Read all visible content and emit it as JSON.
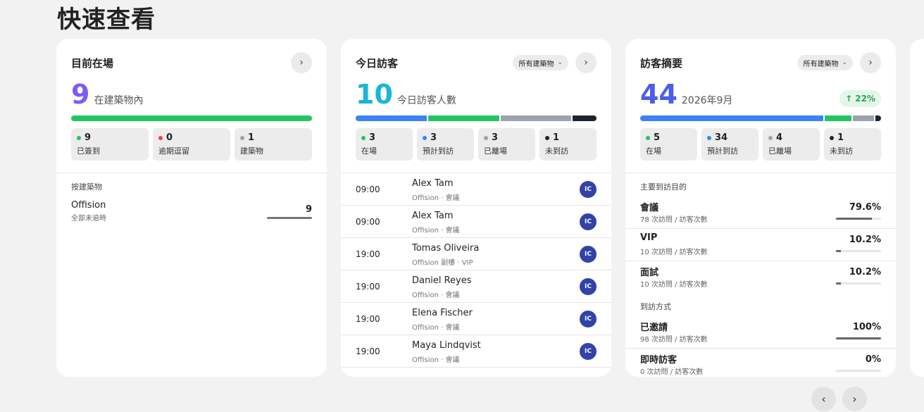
{
  "page_title": "快速查看",
  "colors": {
    "green": "#22c55e",
    "red": "#ef4444",
    "gray": "#9ca3af",
    "dark": "#1e2330",
    "blue": "#3b82f6",
    "purple": "#7c5cf5",
    "cyan": "#19b6d6",
    "indigo": "#4b5ee8"
  },
  "icons": {
    "chevron_right": "›",
    "chevron_down": "⌄",
    "arrow_up": "↑",
    "prev": "‹",
    "next": "›"
  },
  "card1": {
    "title": "目前在場",
    "count": "9",
    "count_label": "在建築物內",
    "stats": [
      {
        "value": "9",
        "label": "已簽到"
      },
      {
        "value": "0",
        "label": "逾期逗留"
      },
      {
        "value": "1",
        "label": "建築物"
      }
    ],
    "section_label": "按建築物",
    "building": {
      "name": "Offision",
      "sub": "全部未逾時",
      "count": "9"
    }
  },
  "card2": {
    "title": "今日訪客",
    "filter": "所有建築物",
    "count": "10",
    "count_label": "今日訪客人數",
    "stats": [
      {
        "value": "3",
        "label": "在場"
      },
      {
        "value": "3",
        "label": "預計到訪"
      },
      {
        "value": "3",
        "label": "已離場"
      },
      {
        "value": "1",
        "label": "未到訪"
      }
    ],
    "visits": [
      {
        "time": "09:00",
        "name": "Alex Tam",
        "sub": "Offision · 會議",
        "initials": "IC"
      },
      {
        "time": "09:00",
        "name": "Alex Tam",
        "sub": "Offision · 會議",
        "initials": "IC"
      },
      {
        "time": "19:00",
        "name": "Tomas Oliveira",
        "sub": "Offision 副樓 · VIP",
        "initials": "IC"
      },
      {
        "time": "19:00",
        "name": "Daniel Reyes",
        "sub": "Offision · 會議",
        "initials": "IC"
      },
      {
        "time": "19:00",
        "name": "Elena Fischer",
        "sub": "Offision · 會議",
        "initials": "IC"
      },
      {
        "time": "19:00",
        "name": "Maya Lindqvist",
        "sub": "Offision · 會議",
        "initials": "IC"
      }
    ]
  },
  "card3": {
    "title": "訪客摘要",
    "filter": "所有建築物",
    "count": "44",
    "count_label": "2026年9月",
    "trend": "22%",
    "stats": [
      {
        "value": "5",
        "label": "在場"
      },
      {
        "value": "34",
        "label": "預計到訪"
      },
      {
        "value": "4",
        "label": "已離場"
      },
      {
        "value": "1",
        "label": "未到訪"
      }
    ],
    "purpose_label": "主要到訪目的",
    "purposes": [
      {
        "name": "會議",
        "sub": "78 次訪問 / 訪客次數",
        "pct": "79.6%",
        "fraction": 0.796
      },
      {
        "name": "VIP",
        "sub": "10 次訪問 / 訪客次數",
        "pct": "10.2%",
        "fraction": 0.102
      },
      {
        "name": "面試",
        "sub": "10 次訪問 / 訪客次數",
        "pct": "10.2%",
        "fraction": 0.102
      }
    ],
    "method_label": "到訪方式",
    "methods": [
      {
        "name": "已邀請",
        "sub": "98 次訪問 / 訪客次數",
        "pct": "100%",
        "fraction": 1.0
      },
      {
        "name": "即時訪客",
        "sub": "0 次訪問 / 訪客次數",
        "pct": "0%",
        "fraction": 0.0
      }
    ]
  }
}
